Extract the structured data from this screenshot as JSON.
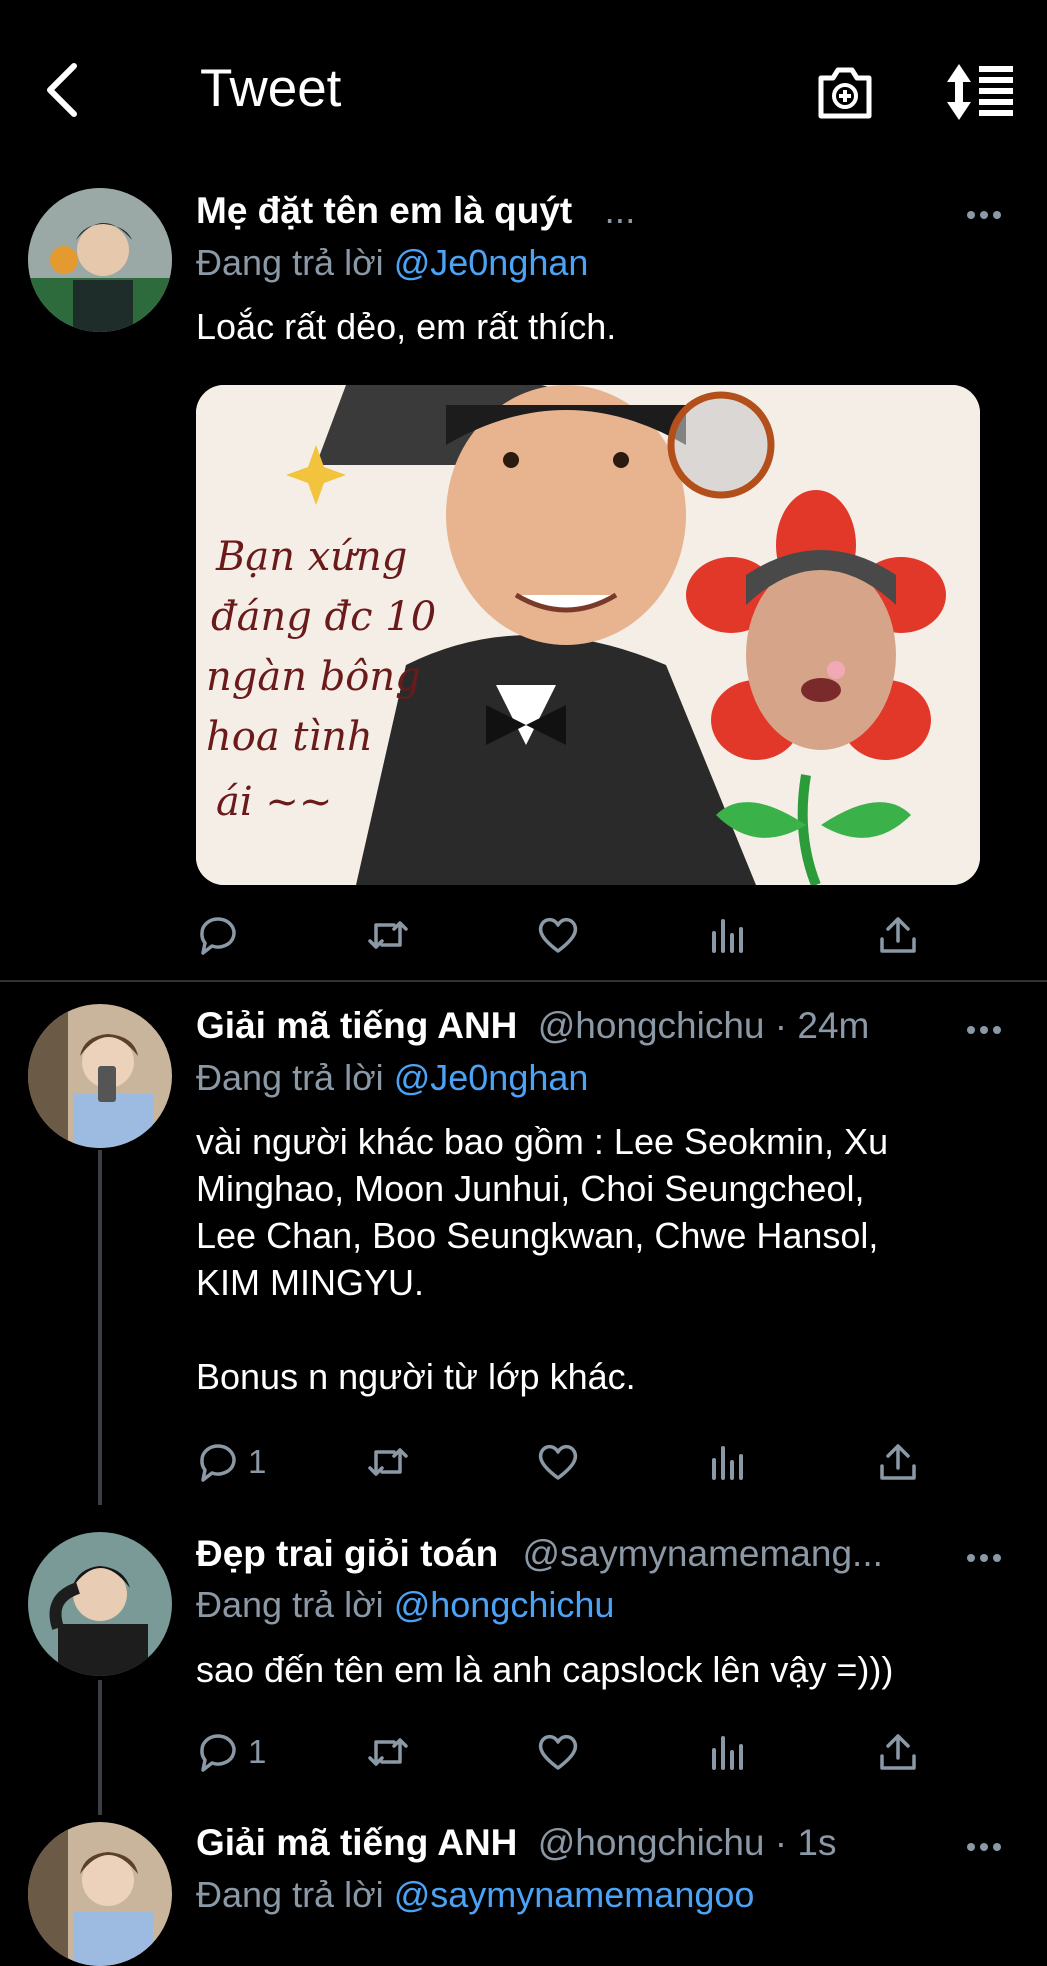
{
  "header": {
    "title": "Tweet"
  },
  "tweets": [
    {
      "name": "Mẹ đặt tên em là quýt",
      "handle_meta": "...",
      "reply_prefix": "Đang trả lời",
      "reply_mention": "@Je0nghan",
      "text": "Loắc rất dẻo, em rất thích.",
      "reply_count": "",
      "media_caption": "Bạn xứng đáng đc 10 ngàn bông hoa tình ái ~~"
    },
    {
      "name": "Giải mã tiếng ANH",
      "handle_meta": "@hongchichu · 24m",
      "reply_prefix": "Đang trả lời",
      "reply_mention": "@Je0nghan",
      "text_lines": [
        "vài người khác bao gồm : Lee Seokmin, Xu",
        "Minghao, Moon Junhui, Choi Seungcheol,",
        "Lee Chan, Boo Seungkwan, Chwe Hansol,",
        "KIM MINGYU.",
        "",
        "Bonus n người từ lớp khác."
      ],
      "reply_count": "1"
    },
    {
      "name": "Đẹp trai giỏi toán",
      "handle_meta": "@saymynamemang...",
      "reply_prefix": "Đang trả lời",
      "reply_mention": "@hongchichu",
      "text": "sao đến tên em là anh capslock lên vậy =)))",
      "reply_count": "1"
    },
    {
      "name": "Giải mã tiếng ANH",
      "handle_meta": "@hongchichu · 1s",
      "reply_prefix": "Đang trả lời",
      "reply_mention": "@saymynamemangoo"
    }
  ],
  "icons": {
    "back": "chevron-left-icon",
    "camera": "camera-plus-icon",
    "sort": "sort-icon",
    "reply": "reply-icon",
    "retweet": "retweet-icon",
    "like": "heart-icon",
    "analytics": "analytics-icon",
    "share": "share-icon"
  },
  "colors": {
    "background": "#000000",
    "mention": "#4ca3f5",
    "secondary": "#8b98a5"
  }
}
